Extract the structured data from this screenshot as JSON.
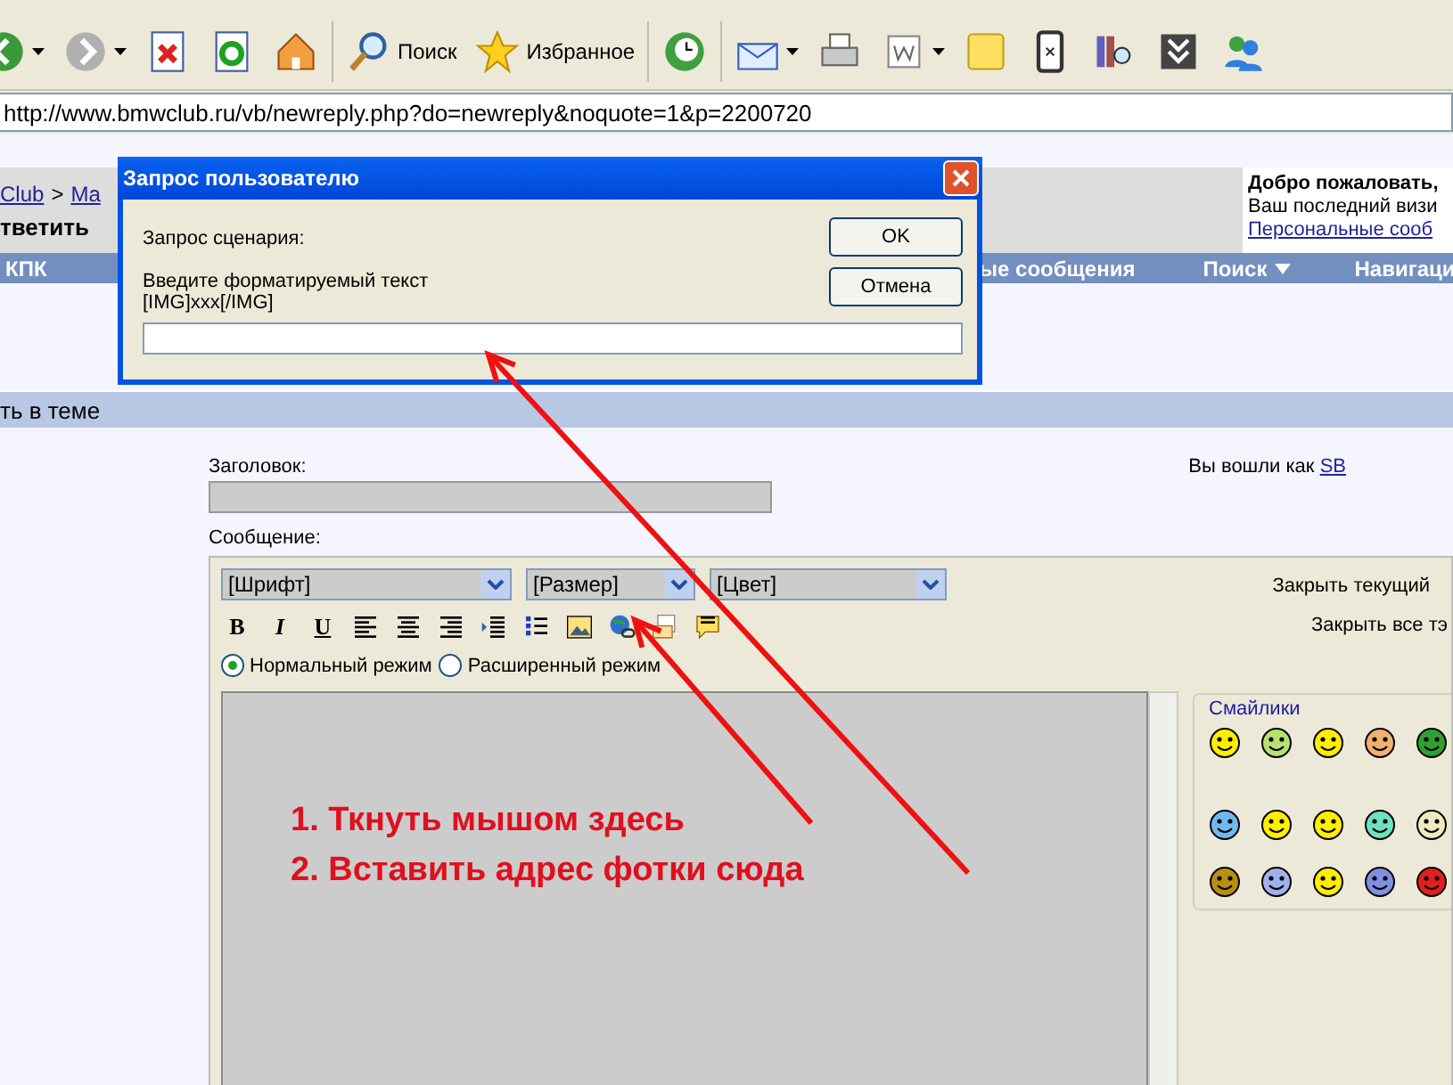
{
  "toolbar": {
    "items": [
      {
        "dropdown": true
      },
      {
        "dropdown": true
      },
      {
        "dropdown": false
      },
      {
        "dropdown": false
      },
      {
        "dropdown": false
      },
      {
        "label": "Поиск",
        "dropdown": false
      },
      {
        "label": "Избранное",
        "dropdown": false
      },
      {
        "dropdown": false
      },
      {
        "dropdown": true
      },
      {
        "dropdown": false
      },
      {
        "dropdown": true
      },
      {
        "dropdown": false
      },
      {
        "dropdown": false
      },
      {
        "dropdown": false
      },
      {
        "dropdown": false
      },
      {
        "dropdown": false
      }
    ]
  },
  "address": "http://www.bmwclub.ru/vb/newreply.php?do=newreply&noquote=1&p=2200720",
  "page": {
    "breadcrumb": [
      "Club",
      ">",
      "Ma"
    ],
    "heading": "тветить",
    "welcome": {
      "title": "Добро пожаловать,",
      "line": "Ваш последний визи",
      "link": "Персональные сооб"
    },
    "nav": [
      {
        "label": "КПК",
        "dropdown": false
      },
      {
        "label": "ые сообщения",
        "dropdown": false
      },
      {
        "label": "Поиск",
        "dropdown": true
      },
      {
        "label": "Навигаци",
        "dropdown": false
      }
    ],
    "section_title": "ть в теме"
  },
  "form": {
    "title_label": "Заголовок:",
    "logged_in": "Вы вошли как",
    "user": "SB",
    "message_label": "Сообщение:",
    "selects": [
      "[Шрифт]",
      "[Размер]",
      "[Цвет]"
    ],
    "format_buttons": [
      {
        "label": "B",
        "kind": "text"
      },
      {
        "label": "I",
        "kind": "text"
      },
      {
        "label": "U",
        "kind": "text"
      },
      {
        "kind": "align-left"
      },
      {
        "kind": "align-center"
      },
      {
        "kind": "align-right"
      },
      {
        "kind": "indent"
      },
      {
        "kind": "list"
      },
      {
        "kind": "image"
      },
      {
        "kind": "link"
      },
      {
        "kind": "email"
      },
      {
        "kind": "quote"
      }
    ],
    "modes": [
      {
        "label": "Нормальный режим",
        "selected": true
      },
      {
        "label": "Расширенный режим",
        "selected": false
      }
    ],
    "close_current": "Закрыть текущий",
    "close_all": "Закрыть все тэ",
    "smilies": {
      "title": "Смайлики",
      "items": [
        {
          "color": "#ffee00"
        },
        {
          "color": "#b8e070"
        },
        {
          "color": "#ffee00"
        },
        {
          "color": "#f0b070"
        },
        {
          "color": "#30a030"
        },
        {
          "color": "#70b8f0"
        },
        {
          "color": "#ffee00"
        },
        {
          "color": "#ffee00"
        },
        {
          "color": "#70e0c0"
        },
        {
          "color": "#f0e8c0"
        },
        {
          "color": "#b89010"
        },
        {
          "color": "#a0b0f0"
        },
        {
          "color": "#ffee00"
        },
        {
          "color": "#8090e0"
        },
        {
          "color": "#e02020"
        }
      ]
    }
  },
  "dialog": {
    "title": "Запрос пользователю",
    "caption": "Запрос сценария:",
    "prompt": "Введите форматируемый текст",
    "example": "[IMG]xxx[/IMG]",
    "buttons": [
      "OK",
      "Отмена"
    ]
  },
  "annotations": [
    "1. Ткнуть мышом здесь",
    "2. Вставить адрес фотки сюда"
  ]
}
